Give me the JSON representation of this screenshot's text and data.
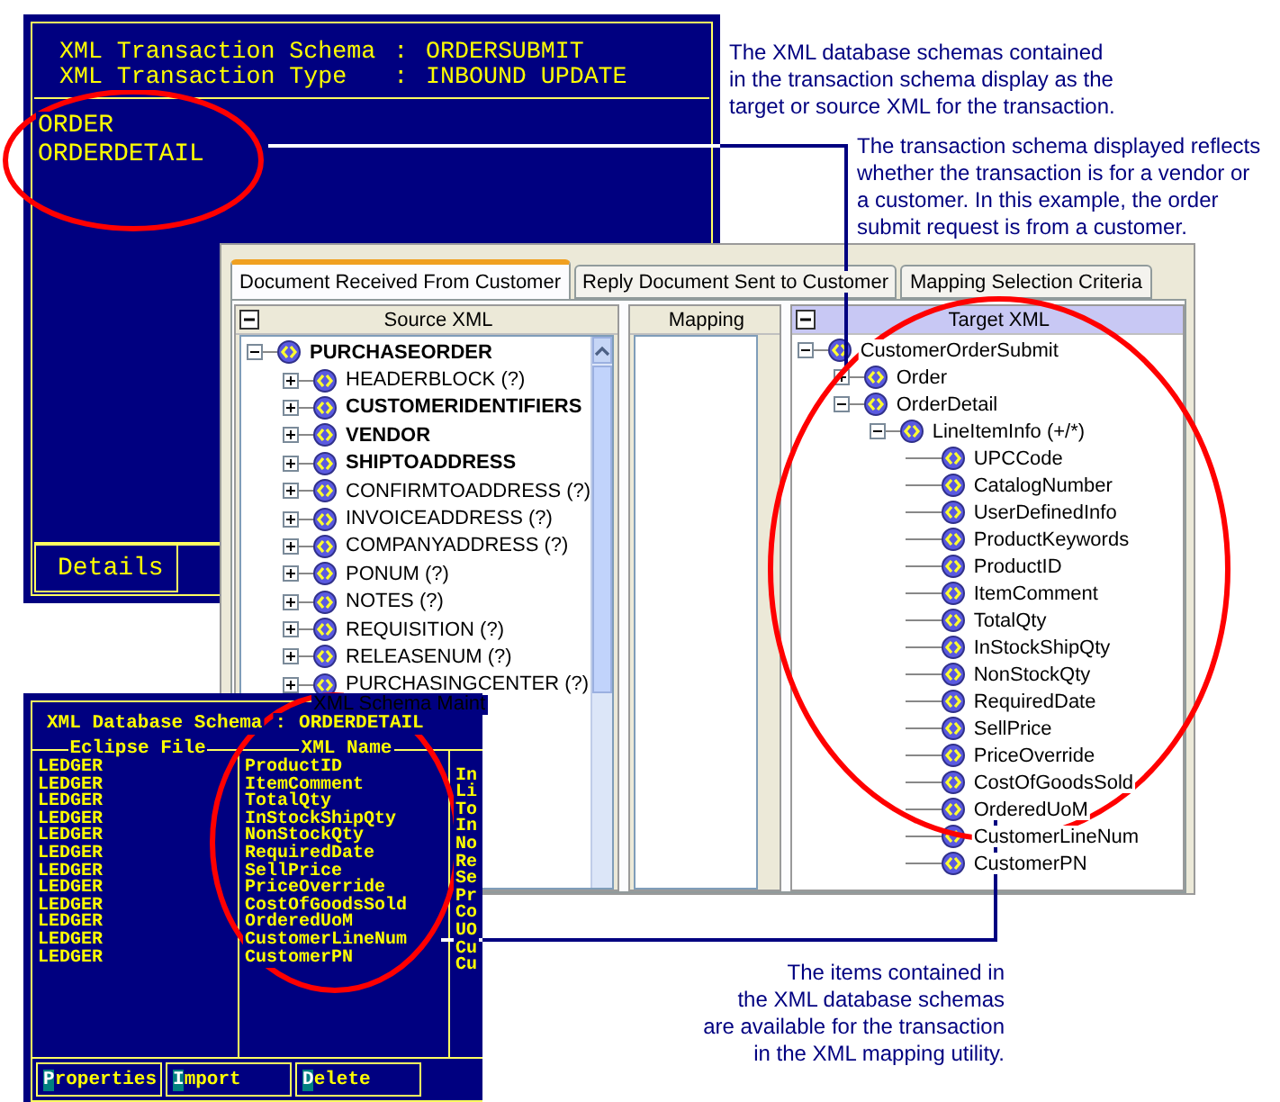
{
  "schema_window": {
    "header": [
      {
        "label": "XML Transaction Schema",
        "sep": ":",
        "value": "ORDERSUBMIT"
      },
      {
        "label": "XML Transaction Type",
        "sep": ":",
        "value": "INBOUND UPDATE"
      }
    ],
    "schemas": [
      "ORDER",
      "ORDERDETAIL"
    ],
    "buttons": [
      "Details"
    ]
  },
  "annotations": [
    {
      "lines": [
        "The XML database schemas contained",
        "in the transaction schema display as the",
        "target or source XML for the transaction."
      ]
    },
    {
      "lines": [
        "The transaction schema displayed reflects",
        "whether the transaction is for a vendor or",
        "a customer. In this example, the order",
        "submit request is from a customer."
      ]
    },
    {
      "lines": [
        "The items contained in",
        "the XML database schemas",
        "are available for the transaction",
        "in the XML mapping utility."
      ]
    }
  ],
  "mapping_window": {
    "tabs": [
      {
        "label": "Document Received From Customer",
        "selected": true
      },
      {
        "label": "Reply Document Sent to Customer",
        "selected": false
      },
      {
        "label": "Mapping Selection Criteria",
        "selected": false
      }
    ],
    "source": {
      "title": "Source XML",
      "tree": {
        "label": "PURCHASEORDER",
        "bold": true,
        "expanded": true,
        "children": [
          {
            "label": "HEADERBLOCK (?)",
            "bold": false,
            "expanded": false
          },
          {
            "label": "CUSTOMERIDENTIFIERS",
            "bold": true,
            "expanded": false
          },
          {
            "label": "VENDOR",
            "bold": true,
            "expanded": false
          },
          {
            "label": "SHIPTOADDRESS",
            "bold": true,
            "expanded": false
          },
          {
            "label": "CONFIRMTOADDRESS (?)",
            "bold": false,
            "expanded": false
          },
          {
            "label": "INVOICEADDRESS (?)",
            "bold": false,
            "expanded": false
          },
          {
            "label": "COMPANYADDRESS (?)",
            "bold": false,
            "expanded": false
          },
          {
            "label": "PONUM (?)",
            "bold": false,
            "expanded": false
          },
          {
            "label": "NOTES (?)",
            "bold": false,
            "expanded": false
          },
          {
            "label": "REQUISITION (?)",
            "bold": false,
            "expanded": false
          },
          {
            "label": "RELEASENUM (?)",
            "bold": false,
            "expanded": false
          },
          {
            "label": "PURCHASINGCENTER (?)",
            "bold": false,
            "expanded": false
          }
        ]
      }
    },
    "mapping": {
      "title": "Mapping"
    },
    "target": {
      "title": "Target XML",
      "tree": {
        "label": "CustomerOrderSubmit",
        "bold": false,
        "expanded": true,
        "children": [
          {
            "label": "Order",
            "bold": false,
            "expanded": false
          },
          {
            "label": "OrderDetail",
            "bold": false,
            "expanded": true,
            "children": [
              {
                "label": "LineItemInfo (+/*)",
                "bold": false,
                "expanded": true,
                "children": [
                  {
                    "label": "UPCCode",
                    "bold": false
                  },
                  {
                    "label": "CatalogNumber",
                    "bold": false
                  },
                  {
                    "label": "UserDefinedInfo",
                    "bold": false
                  },
                  {
                    "label": "ProductKeywords",
                    "bold": false
                  },
                  {
                    "label": "ProductID",
                    "bold": false
                  },
                  {
                    "label": "ItemComment",
                    "bold": false
                  },
                  {
                    "label": "TotalQty",
                    "bold": false
                  },
                  {
                    "label": "InStockShipQty",
                    "bold": false
                  },
                  {
                    "label": "NonStockQty",
                    "bold": false
                  },
                  {
                    "label": "RequiredDate",
                    "bold": false
                  },
                  {
                    "label": "SellPrice",
                    "bold": false
                  },
                  {
                    "label": "PriceOverride",
                    "bold": false
                  },
                  {
                    "label": "CostOfGoodsSold",
                    "bold": false
                  },
                  {
                    "label": "OrderedUoM",
                    "bold": false
                  },
                  {
                    "label": "CustomerLineNum",
                    "bold": false
                  },
                  {
                    "label": "CustomerPN",
                    "bold": false
                  }
                ]
              }
            ]
          }
        ]
      }
    }
  },
  "schema_maintenance_window": {
    "title": "XML Schema Maint",
    "header": {
      "label": "XML Database Schema",
      "sep": ":",
      "value": "ORDERDETAIL"
    },
    "columns": [
      "Eclipse File",
      "XML Name"
    ],
    "rows": [
      {
        "eclipse_file": "LEDGER",
        "xml_name": "ProductID",
        "column_3": "In"
      },
      {
        "eclipse_file": "LEDGER",
        "xml_name": "ItemComment",
        "column_3": "Li"
      },
      {
        "eclipse_file": "LEDGER",
        "xml_name": "TotalQty",
        "column_3": "To"
      },
      {
        "eclipse_file": "LEDGER",
        "xml_name": "InStockShipQty",
        "column_3": "In"
      },
      {
        "eclipse_file": "LEDGER",
        "xml_name": "NonStockQty",
        "column_3": "No"
      },
      {
        "eclipse_file": "LEDGER",
        "xml_name": "RequiredDate",
        "column_3": "Re"
      },
      {
        "eclipse_file": "LEDGER",
        "xml_name": "SellPrice",
        "column_3": "Se"
      },
      {
        "eclipse_file": "LEDGER",
        "xml_name": "PriceOverride",
        "column_3": "Pr"
      },
      {
        "eclipse_file": "LEDGER",
        "xml_name": "CostOfGoodsSold",
        "column_3": "Co"
      },
      {
        "eclipse_file": "LEDGER",
        "xml_name": "OrderedUoM",
        "column_3": "UO"
      },
      {
        "eclipse_file": "LEDGER",
        "xml_name": "CustomerLineNum",
        "column_3": "Cu"
      },
      {
        "eclipse_file": "LEDGER",
        "xml_name": "CustomerPN",
        "column_3": "Cu"
      }
    ],
    "buttons": [
      {
        "hotkey": "P",
        "rest": "roperties"
      },
      {
        "hotkey": "I",
        "rest": "mport"
      },
      {
        "hotkey": "D",
        "rest": "elete"
      }
    ]
  }
}
